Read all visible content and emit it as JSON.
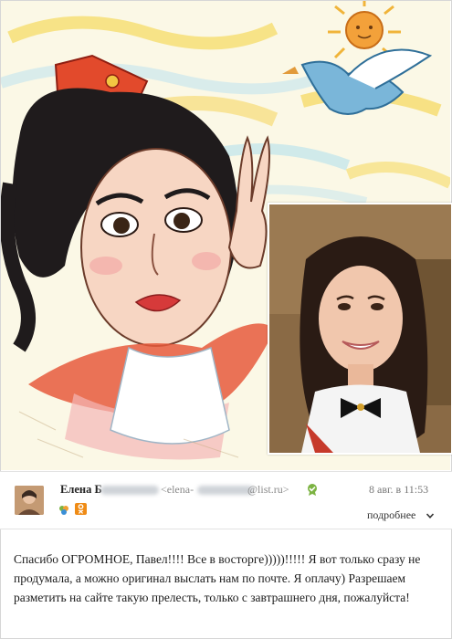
{
  "message": {
    "sender_name": "Елена Б",
    "email_prefix": "<elena-",
    "email_domain": "@list.ru>",
    "date": "8 авг. в 11:53",
    "more_label": "подробнее",
    "body": "Спасибо ОГРОМНОЕ, Павел!!!! Все в восторге)))))!!!!! Я вот только сразу не продумала, а можно оригинал выслать нам по почте. Я оплачу) Разрешаем разметить на сайте такую прелесть, только с завтрашнего дня, пожалуйста!"
  },
  "icons": {
    "verified": "verified-badge-icon",
    "agent": "mail-agent-icon",
    "odnoklassniki": "odnoklassniki-icon",
    "more": "chevron-down-icon"
  },
  "colors": {
    "accent_orange": "#ef8b15",
    "verified_green": "#7cb342",
    "text_dark": "#1d1d1d",
    "text_muted": "#8a8a8a"
  }
}
